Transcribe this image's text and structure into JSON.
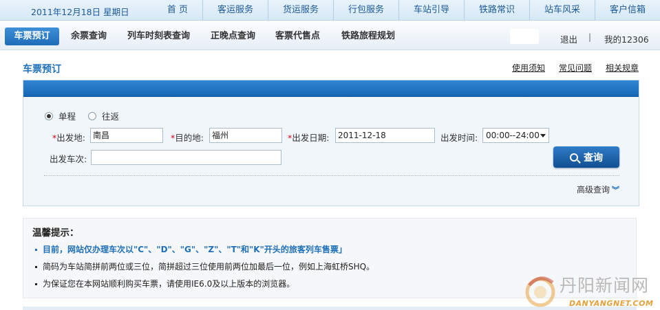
{
  "top_nav": {
    "date": "2011年12月18日 星期日",
    "items": [
      "首 页",
      "客运服务",
      "货运服务",
      "行包服务",
      "车站引导",
      "铁路常识",
      "站车风采",
      "客户信箱"
    ]
  },
  "sub_nav": {
    "tabs": [
      "车票预订",
      "余票查询",
      "列车时刻表查询",
      "正晚点查询",
      "客票代售点",
      "铁路旅程规划"
    ],
    "logout": "退出",
    "separator": "|",
    "my_account": "我的12306"
  },
  "page": {
    "title": "车票预订",
    "help_links": [
      "使用须知",
      "常见问题",
      "相关规章"
    ]
  },
  "form": {
    "trip_type": {
      "one_way": "单程",
      "round_trip": "往返",
      "selected": "单程"
    },
    "required_mark": "*",
    "from_label": "出发地:",
    "from_value": "南昌",
    "to_label": "目的地:",
    "to_value": "福州",
    "date_label": "出发日期:",
    "date_value": "2011-12-18",
    "time_label": "出发时间:",
    "time_value": "00:00--24:00",
    "train_label": "出发车次:",
    "train_value": "",
    "search_button": "查询",
    "advanced": "高级查询",
    "advanced_icon": "double-chevron-down"
  },
  "tips": {
    "title": "温馨提示：",
    "items": [
      "目前，网站仅办理车次以\"C\"、\"D\"、\"G\"、\"Z\"、\"T\"和\"K\"开头的旅客列车售票」",
      "简码为车站简拼前两位或三位，简拼超过三位使用前两位加最后一位，例如上海虹桥SHQ。",
      "为保证您在本网站顺利购买车票，请使用IE6.0及以上版本的浏览器。"
    ]
  },
  "watermark": {
    "text": "丹阳新闻网",
    "sub": "DANYANGNET.COM"
  },
  "colors": {
    "accent": "#1e6fb8",
    "required": "#d0021b",
    "panel_bar": "#1f6cb8"
  }
}
